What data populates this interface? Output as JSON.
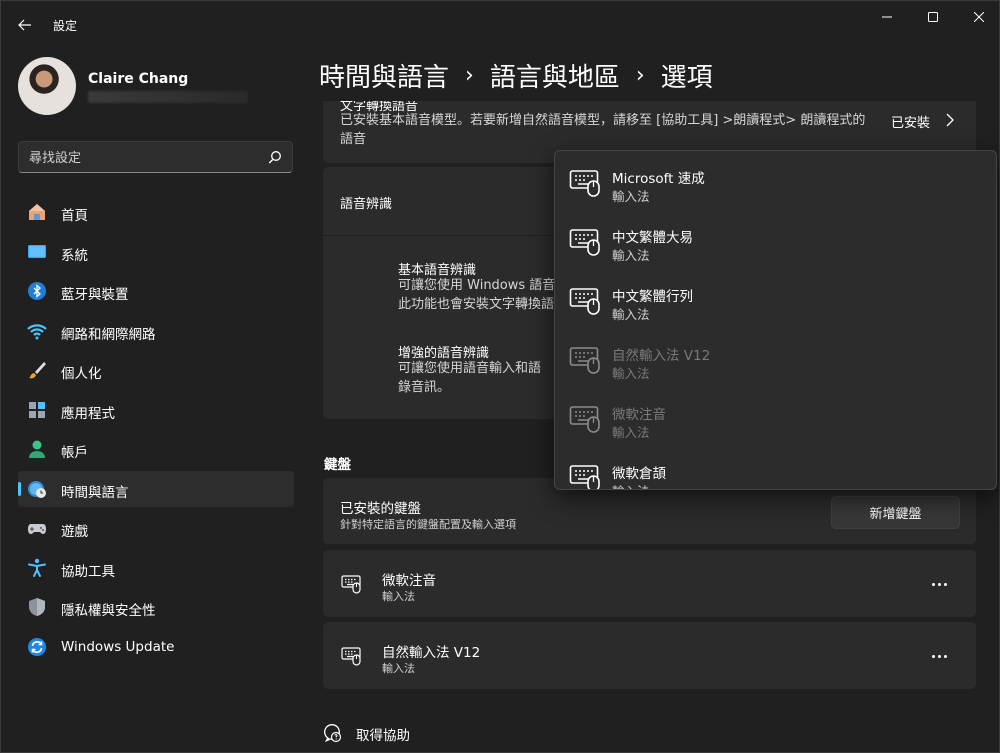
{
  "window": {
    "title": "設定"
  },
  "profile": {
    "name": "Claire Chang"
  },
  "search": {
    "placeholder": "尋找設定"
  },
  "sidebar": {
    "items": [
      {
        "label": "首頁",
        "icon": "home-icon"
      },
      {
        "label": "系統",
        "icon": "system-icon"
      },
      {
        "label": "藍牙與裝置",
        "icon": "bluetooth-icon"
      },
      {
        "label": "網路和網際網路",
        "icon": "wifi-icon"
      },
      {
        "label": "個人化",
        "icon": "brush-icon"
      },
      {
        "label": "應用程式",
        "icon": "apps-icon"
      },
      {
        "label": "帳戶",
        "icon": "account-icon"
      },
      {
        "label": "時間與語言",
        "icon": "time-language-icon",
        "active": true
      },
      {
        "label": "遊戲",
        "icon": "gamepad-icon"
      },
      {
        "label": "協助工具",
        "icon": "accessibility-icon"
      },
      {
        "label": "隱私權與安全性",
        "icon": "shield-icon"
      },
      {
        "label": "Windows Update",
        "icon": "update-icon"
      }
    ]
  },
  "breadcrumb": {
    "items": [
      "時間與語言",
      "語言與地區",
      "選項"
    ],
    "separator": "›"
  },
  "tts": {
    "title_cut": "文字轉換語音",
    "description": "已安裝基本語音模型。若要新增自然語音模型，請移至 [協助工具] >朗讀程式> 朗讀程式的語音",
    "status": "已安裝"
  },
  "speech": {
    "title": "語音辨識",
    "basic_title": "基本語音辨識",
    "basic_desc_1": "可讓您使用 Windows 語音",
    "basic_desc_2": "此功能也會安裝文字轉換語",
    "enhanced_title": "增強的語音辨識",
    "enhanced_desc_1": "可讓您使用語音輸入和語",
    "enhanced_desc_2": "錄音訊。"
  },
  "keyboard": {
    "section_title": "鍵盤",
    "installed_title": "已安裝的鍵盤",
    "installed_sub": "針對特定語言的鍵盤配置及輸入選項",
    "add_button": "新增鍵盤",
    "items": [
      {
        "name": "微軟注音",
        "type": "輸入法"
      },
      {
        "name": "自然輸入法 V12",
        "type": "輸入法"
      }
    ]
  },
  "popup": {
    "items": [
      {
        "name": "Microsoft 速成",
        "type": "輸入法",
        "enabled": true
      },
      {
        "name": "中文繁體大易",
        "type": "輸入法",
        "enabled": true
      },
      {
        "name": "中文繁體行列",
        "type": "輸入法",
        "enabled": true
      },
      {
        "name": "自然輸入法 V12",
        "type": "輸入法",
        "enabled": false
      },
      {
        "name": "微軟注音",
        "type": "輸入法",
        "enabled": false
      },
      {
        "name": "微軟倉頡",
        "type": "輸入法",
        "enabled": true
      }
    ]
  },
  "help": {
    "label": "取得協助"
  },
  "colors": {
    "accent": "#4cc2ff",
    "background": "#202020",
    "card": "#2b2b2b"
  }
}
